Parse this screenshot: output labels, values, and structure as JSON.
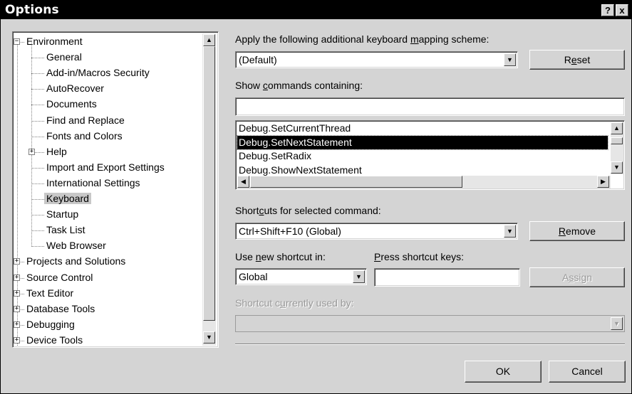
{
  "window": {
    "title": "Options",
    "help_label": "?",
    "close_label": "x"
  },
  "tree": {
    "items": [
      {
        "label": "Environment",
        "level": 0,
        "expander": "minus"
      },
      {
        "label": "General",
        "level": 1
      },
      {
        "label": "Add-in/Macros Security",
        "level": 1
      },
      {
        "label": "AutoRecover",
        "level": 1
      },
      {
        "label": "Documents",
        "level": 1
      },
      {
        "label": "Find and Replace",
        "level": 1
      },
      {
        "label": "Fonts and Colors",
        "level": 1
      },
      {
        "label": "Help",
        "level": 1,
        "expander": "plus"
      },
      {
        "label": "Import and Export Settings",
        "level": 1
      },
      {
        "label": "International Settings",
        "level": 1
      },
      {
        "label": "Keyboard",
        "level": 1,
        "selected": true
      },
      {
        "label": "Startup",
        "level": 1
      },
      {
        "label": "Task List",
        "level": 1
      },
      {
        "label": "Web Browser",
        "level": 1
      },
      {
        "label": "Projects and Solutions",
        "level": 0,
        "expander": "plus"
      },
      {
        "label": "Source Control",
        "level": 0,
        "expander": "plus"
      },
      {
        "label": "Text Editor",
        "level": 0,
        "expander": "plus"
      },
      {
        "label": "Database Tools",
        "level": 0,
        "expander": "plus"
      },
      {
        "label": "Debugging",
        "level": 0,
        "expander": "plus"
      },
      {
        "label": "Device Tools",
        "level": 0,
        "expander": "plus"
      }
    ]
  },
  "mapping": {
    "label_pre": "Apply the following additional keyboard ",
    "label_accel": "m",
    "label_post": "apping scheme:",
    "value": "(Default)",
    "reset_pre": "R",
    "reset_accel": "e",
    "reset_post": "set"
  },
  "commands": {
    "label_pre": "Show ",
    "label_accel": "c",
    "label_post": "ommands containing:",
    "filter_value": "",
    "list": [
      {
        "label": "Debug.SetCurrentThread"
      },
      {
        "label": "Debug.SetNextStatement",
        "selected": true
      },
      {
        "label": "Debug.SetRadix"
      },
      {
        "label": "Debug.ShowNextStatement"
      }
    ]
  },
  "shortcuts": {
    "label_pre": "Short",
    "label_accel": "c",
    "label_post": "uts for selected command:",
    "value": "Ctrl+Shift+F10 (Global)",
    "remove_accel": "R",
    "remove_post": "emove"
  },
  "new_shortcut": {
    "use_in_pre": "Use ",
    "use_in_accel": "n",
    "use_in_post": "ew shortcut in:",
    "use_in_value": "Global",
    "press_accel": "P",
    "press_post": "ress shortcut keys:",
    "press_value": "",
    "assign_pre": "A",
    "assign_accel": "s",
    "assign_post": "sign"
  },
  "used_by": {
    "label_pre": "Shortcut c",
    "label_accel": "u",
    "label_post": "rrently used by:",
    "value": ""
  },
  "footer": {
    "ok_label": "OK",
    "cancel_label": "Cancel"
  },
  "glyphs": {
    "up": "▲",
    "down": "▼",
    "left": "◀",
    "right": "▶",
    "plus": "+",
    "minus": "−"
  }
}
